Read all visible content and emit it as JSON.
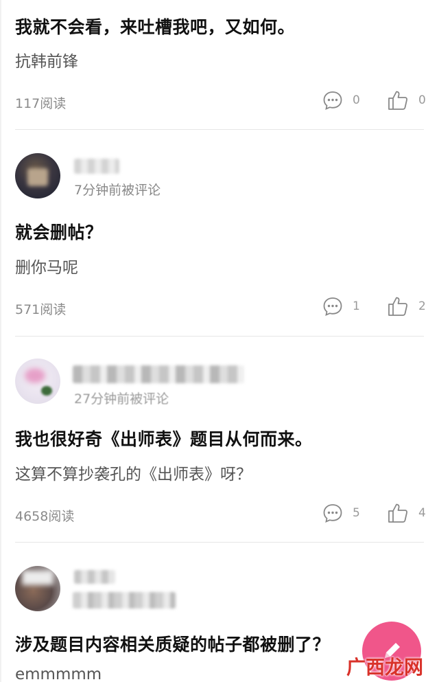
{
  "posts": [
    {
      "title": "我就不会看，来吐槽我吧，又如何。",
      "body": "抗韩前锋",
      "reads": "117阅读",
      "comments": "0",
      "likes": "0"
    },
    {
      "time": "7分钟前被评论",
      "title": "就会删帖？",
      "body": "删你马呢",
      "reads": "571阅读",
      "comments": "1",
      "likes": "2"
    },
    {
      "time": "27分钟前被评论",
      "title": "我也很好奇《出师表》题目从何而来。",
      "body": "这算不算抄袭孔的《出师表》呀？",
      "reads": "4658阅读",
      "comments": "5",
      "likes": "4"
    },
    {
      "title": "涉及题目内容相关质疑的帖子都被删了？",
      "body": "emmmmm"
    }
  ],
  "icons": {
    "comment": "comment-bubble-icon",
    "like": "thumbs-up-icon",
    "compose": "pencil-icon"
  },
  "colors": {
    "fab": "#f0568a",
    "watermark": "#d9322a"
  },
  "watermark": "广西龙网"
}
